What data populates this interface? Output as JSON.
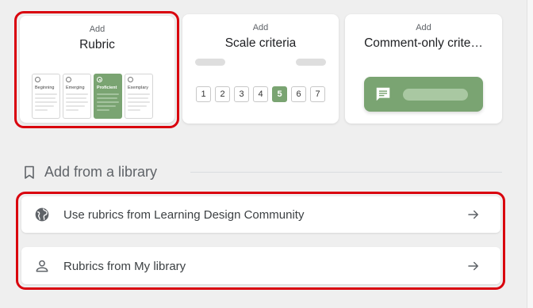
{
  "cards": {
    "rubric": {
      "small": "Add",
      "title": "Rubric",
      "levels": [
        "Beginning",
        "Emerging",
        "Proficient",
        "Exemplary"
      ],
      "selected_level": "Proficient"
    },
    "scale": {
      "small": "Add",
      "title": "Scale criteria",
      "numbers": [
        "1",
        "2",
        "3",
        "4",
        "5",
        "6",
        "7"
      ],
      "selected": "5"
    },
    "comment": {
      "small": "Add",
      "title": "Comment-only crite…",
      "icon": "comment-icon"
    }
  },
  "library": {
    "heading": "Add from a library",
    "heading_icon": "bookmark-icon",
    "items": [
      {
        "label": "Use rubrics from Learning Design Community",
        "icon": "globe-icon"
      },
      {
        "label": "Rubrics from My library",
        "icon": "person-icon"
      }
    ],
    "arrow_icon": "arrow-right-icon"
  },
  "colors": {
    "accent_green": "#7aa472",
    "highlight_red": "#d9000d",
    "background": "#efefef"
  }
}
